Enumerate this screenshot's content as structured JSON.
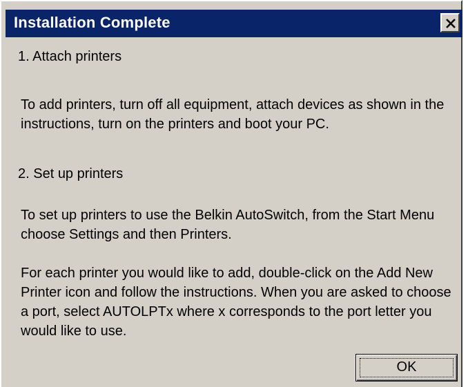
{
  "dialog": {
    "title": "Installation Complete",
    "title_bar_color": "#0a246a",
    "background_color": "#d4d0c8",
    "close_icon": "close-x-icon"
  },
  "content": {
    "step1_heading": "1. Attach printers",
    "step1_text": "To add printers, turn off all equipment, attach devices as shown in the instructions, turn on the printers and boot your PC.",
    "step2_heading": "2. Set up printers",
    "step2_text": "To set up printers to use the Belkin AutoSwitch, from the Start Menu choose Settings and then Printers.",
    "step2_detail": "For each printer you would like to add, double-click on the Add New Printer icon and follow the instructions. When you are asked to choose a port, select AUTOLPTx where x corresponds to the port letter you would like to use."
  },
  "buttons": {
    "ok_label": "OK"
  }
}
